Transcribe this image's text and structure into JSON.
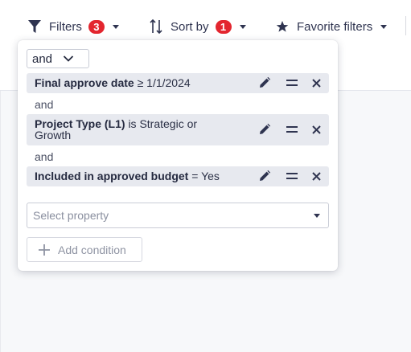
{
  "toolbar": {
    "filters": {
      "label": "Filters",
      "count": "3"
    },
    "sort": {
      "label": "Sort by",
      "count": "1"
    },
    "favorites": {
      "label": "Favorite filters"
    }
  },
  "filter_panel": {
    "operator": "and",
    "joiners": [
      "and",
      "and"
    ],
    "conditions": [
      {
        "field": "Final approve date",
        "operator": "≥",
        "value": "1/1/2024"
      },
      {
        "field": "Project Type (L1)",
        "operator": "is",
        "value": "Strategic or",
        "value_line2": "Growth"
      },
      {
        "field": "Included in approved budget",
        "operator": "=",
        "value": "Yes"
      }
    ],
    "select_property_placeholder": "Select property",
    "add_condition_label": "Add condition"
  },
  "colors": {
    "badge": "#e3262f",
    "condition_bg": "#e7e9ef",
    "text": "#2a2f45",
    "icon": "#2f3450"
  },
  "icons": [
    "funnel-icon",
    "sort-arrows-icon",
    "star-icon",
    "pencil-icon",
    "drag-handle-icon",
    "close-icon",
    "chevron-down-icon",
    "plus-icon"
  ]
}
